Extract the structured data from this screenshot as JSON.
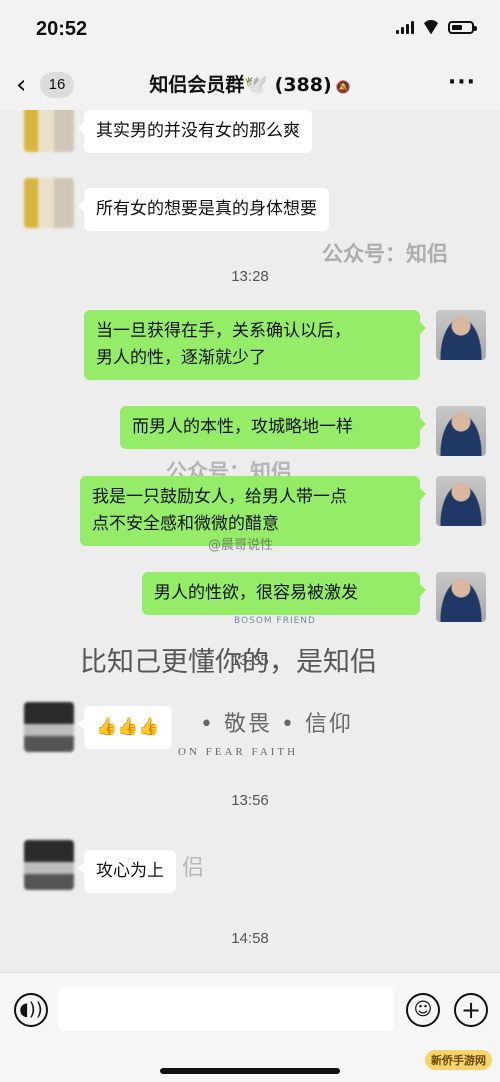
{
  "status_bar": {
    "time": "20:52"
  },
  "nav": {
    "back_icon": "chevron-left-icon",
    "unread_count": "16",
    "title": "知侣会员群🕊️ (388)",
    "mute_icon": "bell-off-icon",
    "more_icon": "ellipsis-icon"
  },
  "messages": {
    "m1": "其实男的并没有女的那么爽",
    "m2": "所有女的想要是真的身体想要",
    "t1": "13:28",
    "m3": "当一旦获得在手，关系确认以后，\n男人的性，逐渐就少了",
    "m4": "而男人的本性，攻城略地一样",
    "m5": "我是一只鼓励女人，给男人带一点\n点不安全感和微微的醋意",
    "m6": "男人的性欲，很容易被激发",
    "t2": "13:35",
    "m7": "👍👍👍",
    "t3": "13:56",
    "m8": "攻心为上",
    "t4": "14:58"
  },
  "watermarks": {
    "w1": "公众号：知侣",
    "w2": "公众号：知侣",
    "w3": "@晨哥说性",
    "w4": "BOSOM FRIEND"
  },
  "overlay": {
    "slogan": "比知己更懂你的，是知侣",
    "values": "• 敬畏 • 信仰",
    "values_en": "ON      FEAR      FAITH",
    "fragment": "侣"
  },
  "input_bar": {
    "voice_icon": "voice-icon",
    "emoji_icon": "emoji-icon",
    "plus_icon": "plus-icon",
    "input_value": ""
  },
  "site_logo": "新侨手游网"
}
